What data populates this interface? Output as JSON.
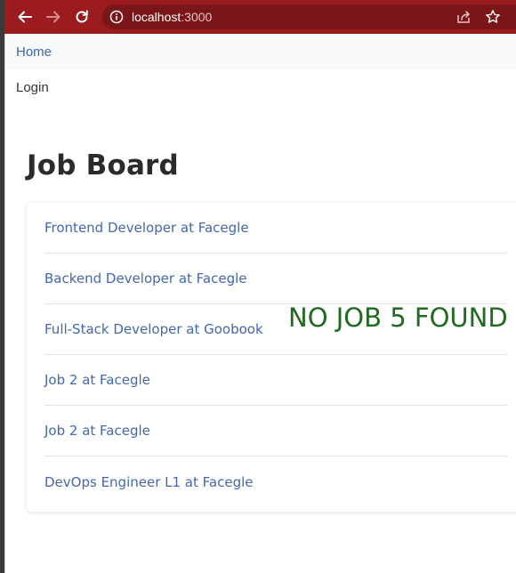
{
  "browser": {
    "url_host": "localhost",
    "url_port": ":3000",
    "accent_color": "#9b1b1e",
    "icons": [
      "back-arrow-icon",
      "forward-arrow-icon",
      "reload-icon",
      "info-icon",
      "share-icon",
      "star-icon"
    ]
  },
  "nav": {
    "home_label": "Home",
    "login_label": "Login"
  },
  "page": {
    "title": "Job Board"
  },
  "jobs": [
    {
      "label": "Frontend Developer at Facegle"
    },
    {
      "label": "Backend Developer at Facegle"
    },
    {
      "label": "Full-Stack Developer at Goobook"
    },
    {
      "label": "Job 2 at Facegle"
    },
    {
      "label": "Job 2 at Facegle"
    },
    {
      "label": "DevOps Engineer L1 at Facegle"
    }
  ],
  "message": {
    "text": "NO JOB 5 FOUND",
    "color": "#1f6b1f"
  }
}
